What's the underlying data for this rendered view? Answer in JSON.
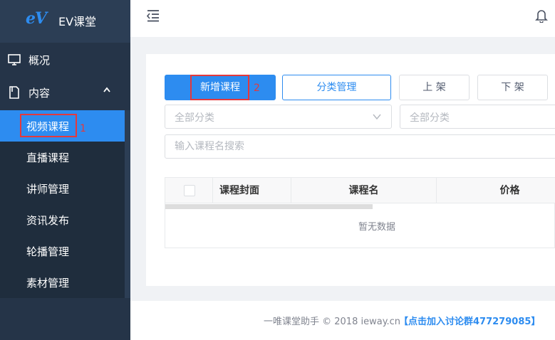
{
  "brand": {
    "logo_mark": "eV",
    "name": "EV课堂"
  },
  "sidebar": {
    "overview": "概况",
    "content": "内容",
    "items": [
      "视频课程",
      "直播课程",
      "讲师管理",
      "资讯发布",
      "轮播管理",
      "素材管理"
    ],
    "active_item": "视频课程"
  },
  "annotations": {
    "mark1": "1",
    "mark2": "2"
  },
  "toolbar": {
    "add_course": "新增课程",
    "category_manage": "分类管理",
    "publish": "上 架",
    "unpublish": "下 架"
  },
  "filters": {
    "category_select_1": "全部分类",
    "category_select_2": "全部分类",
    "search_placeholder": "输入课程名搜索"
  },
  "table": {
    "columns": [
      "课程封面",
      "课程名",
      "价格"
    ],
    "rows": [],
    "empty_text": "暂无数据"
  },
  "footer": {
    "copyright": "一唯课堂助手 © 2018 ieway.cn",
    "join_link": "【点击加入讨论群477279085】"
  },
  "colors": {
    "sidebar_bg": "#253448",
    "accent": "#2d8cf0",
    "annotation": "#e4393c"
  }
}
